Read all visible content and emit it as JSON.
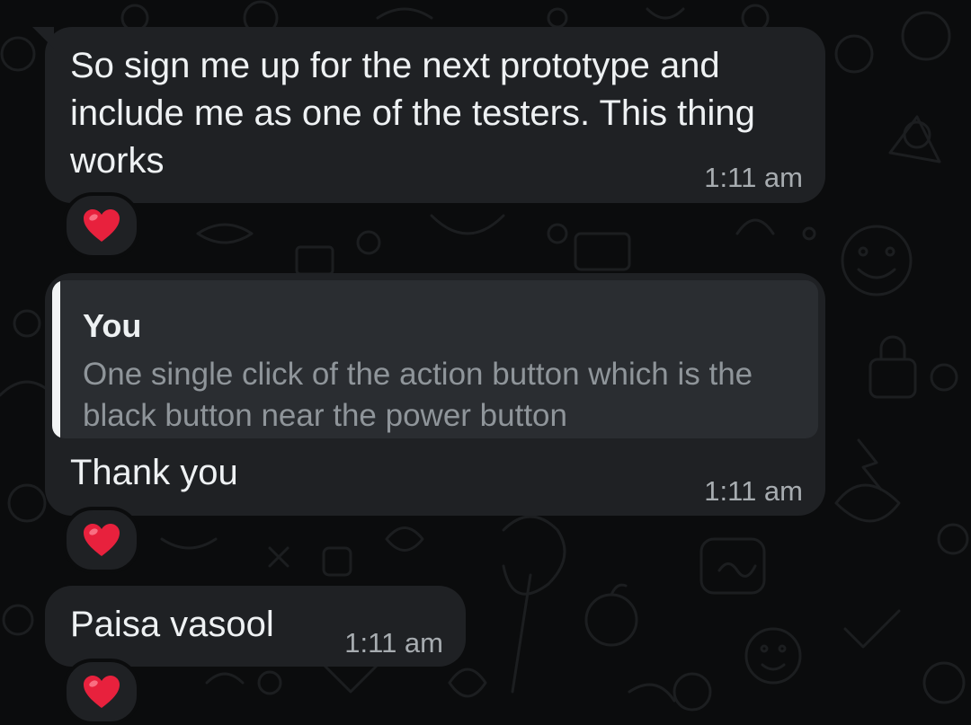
{
  "messages": [
    {
      "text": "So sign me up for the next prototype and include me as one of the testers. This thing works",
      "time": "1:11 am",
      "reaction": "❤️"
    },
    {
      "quote": {
        "author": "You",
        "text": "One single click of the action button which is the black button near the power button"
      },
      "text": "Thank you",
      "time": "1:11 am",
      "reaction": "❤️"
    },
    {
      "text": "Paisa vasool",
      "time": "1:11 am",
      "reaction": "❤️"
    }
  ],
  "colors": {
    "background": "#0b0c0d",
    "bubble": "#1f2124",
    "quote_background": "#2a2d31",
    "quote_bar": "#f2f4f5",
    "text": "#eef1f3",
    "secondary_text": "#a7acb0"
  }
}
